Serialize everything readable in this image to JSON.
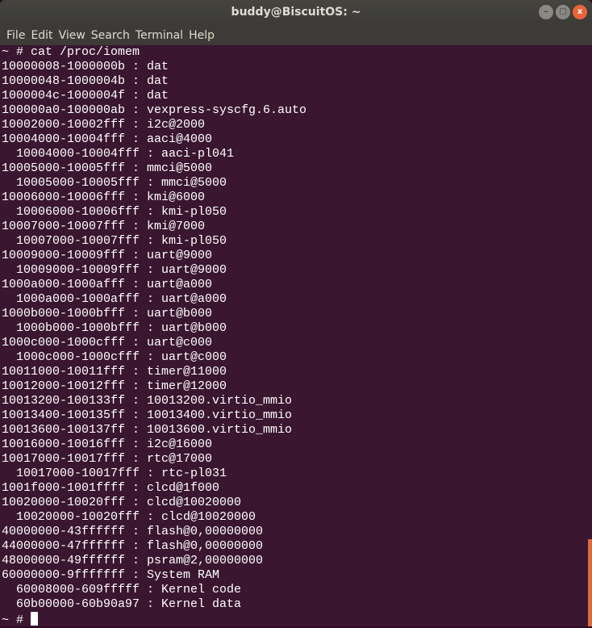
{
  "window": {
    "title": "buddy@BiscuitOS: ~"
  },
  "menu": [
    "File",
    "Edit",
    "View",
    "Search",
    "Terminal",
    "Help"
  ],
  "terminal": {
    "command_line": "~ # cat /proc/iomem",
    "lines": [
      "10000008-1000000b : dat",
      "10000048-1000004b : dat",
      "1000004c-1000004f : dat",
      "100000a0-100000ab : vexpress-syscfg.6.auto",
      "10002000-10002fff : i2c@2000",
      "10004000-10004fff : aaci@4000",
      "  10004000-10004fff : aaci-pl041",
      "10005000-10005fff : mmci@5000",
      "  10005000-10005fff : mmci@5000",
      "10006000-10006fff : kmi@6000",
      "  10006000-10006fff : kmi-pl050",
      "10007000-10007fff : kmi@7000",
      "  10007000-10007fff : kmi-pl050",
      "10009000-10009fff : uart@9000",
      "  10009000-10009fff : uart@9000",
      "1000a000-1000afff : uart@a000",
      "  1000a000-1000afff : uart@a000",
      "1000b000-1000bfff : uart@b000",
      "  1000b000-1000bfff : uart@b000",
      "1000c000-1000cfff : uart@c000",
      "  1000c000-1000cfff : uart@c000",
      "10011000-10011fff : timer@11000",
      "10012000-10012fff : timer@12000",
      "10013200-100133ff : 10013200.virtio_mmio",
      "10013400-100135ff : 10013400.virtio_mmio",
      "10013600-100137ff : 10013600.virtio_mmio",
      "10016000-10016fff : i2c@16000",
      "10017000-10017fff : rtc@17000",
      "  10017000-10017fff : rtc-pl031",
      "1001f000-1001ffff : clcd@1f000",
      "10020000-10020fff : clcd@10020000",
      "  10020000-10020fff : clcd@10020000",
      "40000000-43ffffff : flash@0,00000000",
      "44000000-47ffffff : flash@0,00000000",
      "48000000-49ffffff : psram@2,00000000",
      "60000000-9fffffff : System RAM",
      "  60008000-609fffff : Kernel code",
      "  60b00000-60b90a97 : Kernel data"
    ],
    "prompt": "~ # "
  }
}
